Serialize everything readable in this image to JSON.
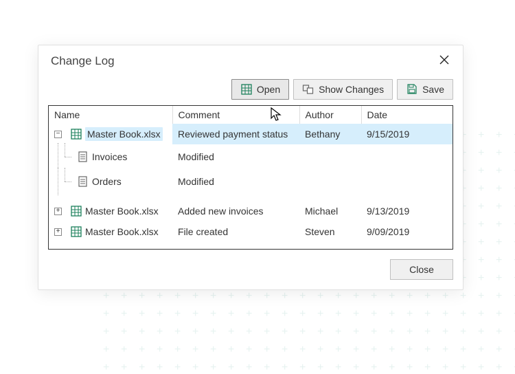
{
  "dialog": {
    "title": "Change Log",
    "buttons": {
      "open": "Open",
      "show_changes": "Show Changes",
      "save": "Save",
      "close": "Close"
    },
    "columns": {
      "name": "Name",
      "comment": "Comment",
      "author": "Author",
      "date": "Date"
    }
  },
  "entries": [
    {
      "expanded": true,
      "selected": true,
      "name": "Master Book.xlsx",
      "comment": "Reviewed payment status",
      "author": "Bethany",
      "date": "9/15/2019",
      "children": [
        {
          "name": "Invoices",
          "comment": "Modified"
        },
        {
          "name": "Orders",
          "comment": "Modified"
        }
      ]
    },
    {
      "expanded": false,
      "name": "Master Book.xlsx",
      "comment": "Added new invoices",
      "author": "Michael",
      "date": "9/13/2019"
    },
    {
      "expanded": false,
      "name": "Master Book.xlsx",
      "comment": "File created",
      "author": "Steven",
      "date": "9/09/2019"
    }
  ],
  "icons": {
    "excel_color": "#1a7f5a",
    "sheet_color": "#555"
  }
}
